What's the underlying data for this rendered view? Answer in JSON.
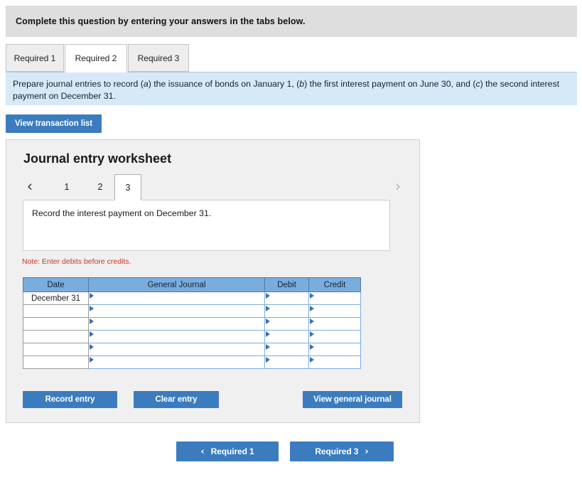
{
  "banner": {
    "text": "Complete this question by entering your answers in the tabs below."
  },
  "tabs": [
    {
      "label": "Required 1",
      "active": false
    },
    {
      "label": "Required 2",
      "active": true
    },
    {
      "label": "Required 3",
      "active": false
    }
  ],
  "instruction": {
    "part1": "Prepare journal entries to record (",
    "a": "a",
    "part2": ") the issuance of bonds on January 1, (",
    "b": "b",
    "part3": ") the first interest payment on June 30, and (",
    "c": "c",
    "part4": ") the second interest payment on December 31."
  },
  "toolbar": {
    "view_transaction_list": "View transaction list"
  },
  "worksheet": {
    "title": "Journal entry worksheet",
    "pager": {
      "prev_icon": "‹",
      "next_icon": "›",
      "pages": [
        "1",
        "2",
        "3"
      ],
      "active_page": "3"
    },
    "description": "Record the interest payment on December 31.",
    "note": "Note: Enter debits before credits.",
    "table": {
      "columns": [
        "Date",
        "General Journal",
        "Debit",
        "Credit"
      ],
      "rows": [
        {
          "date": "December 31",
          "general_journal": "",
          "debit": "",
          "credit": ""
        },
        {
          "date": "",
          "general_journal": "",
          "debit": "",
          "credit": ""
        },
        {
          "date": "",
          "general_journal": "",
          "debit": "",
          "credit": ""
        },
        {
          "date": "",
          "general_journal": "",
          "debit": "",
          "credit": ""
        },
        {
          "date": "",
          "general_journal": "",
          "debit": "",
          "credit": ""
        },
        {
          "date": "",
          "general_journal": "",
          "debit": "",
          "credit": ""
        }
      ]
    },
    "actions": {
      "record_entry": "Record entry",
      "clear_entry": "Clear entry",
      "view_general_journal": "View general journal"
    }
  },
  "footer_nav": {
    "prev_label": "Required 1",
    "prev_icon": "‹",
    "next_label": "Required 3",
    "next_icon": "›"
  },
  "colors": {
    "accent_blue": "#3b7cbf",
    "header_blue": "#7aaddd",
    "instruction_blue": "#d6e9f8",
    "banner_gray": "#dedede",
    "panel_gray": "#f0f0f0",
    "note_red": "#c0392b"
  }
}
